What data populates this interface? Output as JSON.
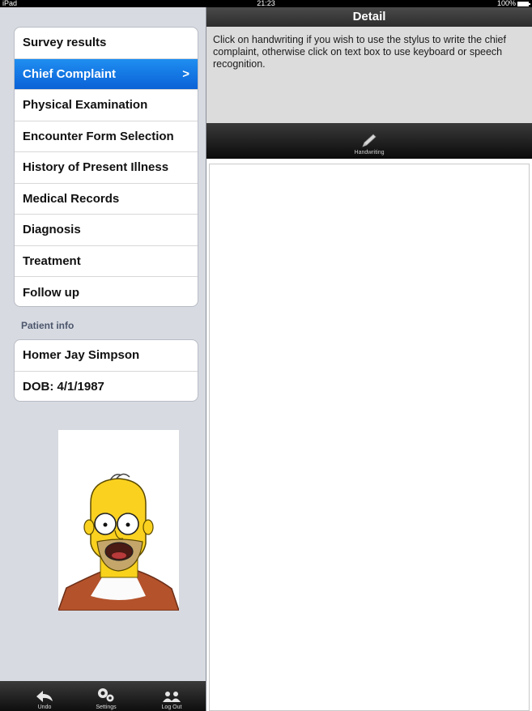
{
  "status_bar": {
    "carrier": "iPad",
    "time": "21:23",
    "battery": "100%"
  },
  "menu": {
    "items": [
      {
        "label": "Survey results"
      },
      {
        "label": "Chief Complaint",
        "selected": true
      },
      {
        "label": "Physical Examination"
      },
      {
        "label": "Encounter Form Selection"
      },
      {
        "label": "History of Present Illness"
      },
      {
        "label": "Medical Records"
      },
      {
        "label": "Diagnosis"
      },
      {
        "label": "Treatment"
      },
      {
        "label": "Follow up"
      }
    ],
    "chevron": ">"
  },
  "patient_info": {
    "section_title": "Patient info",
    "name": "Homer Jay Simpson",
    "dob": "DOB: 4/1/1987"
  },
  "bottom_toolbar": {
    "undo_label": "Undo",
    "settings_label": "Settings",
    "logout_label": "Log Out"
  },
  "detail": {
    "title": "Detail",
    "instructions": "Click on handwriting if you wish to use the stylus to write the chief complaint, otherwise click on text box to use keyboard or speech recognition.",
    "handwriting_label": "Handwriting",
    "textarea_value": ""
  },
  "colors": {
    "selected_row": "#1678e8",
    "sidebar_bg": "#d7dae1",
    "bar_dark": "#1a1a1a"
  },
  "icons": [
    "undo-icon",
    "settings-icon",
    "logout-icon",
    "pencil-icon",
    "battery-icon"
  ]
}
